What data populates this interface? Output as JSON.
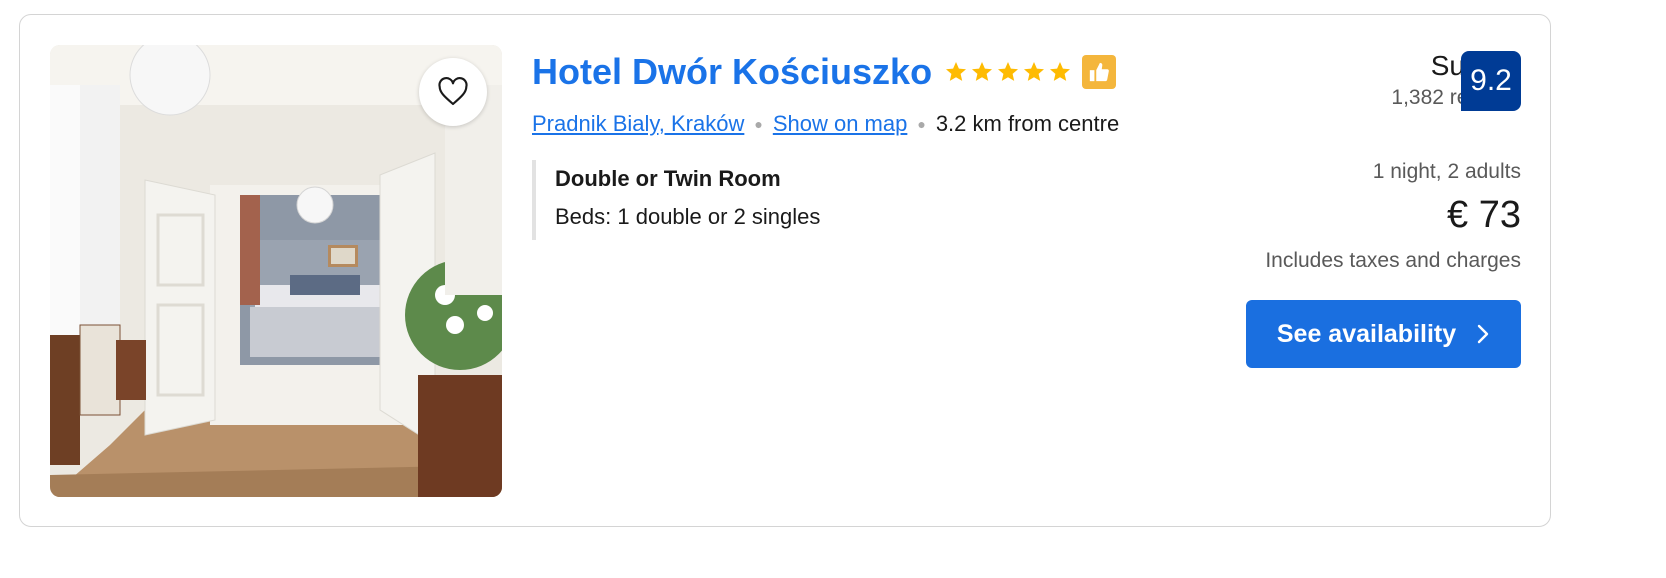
{
  "hotel": {
    "name": "Hotel Dwór Kościuszko",
    "stars": 5,
    "location_link": "Pradnik Bialy, Kraków",
    "map_link": "Show on map",
    "distance": "3.2 km from centre"
  },
  "room": {
    "name": "Double or Twin Room",
    "beds": "Beds: 1 double or 2 singles"
  },
  "review": {
    "label": "Superb",
    "count": "1,382 reviews",
    "score": "9.2"
  },
  "price": {
    "stay": "1 night, 2 adults",
    "amount": "€ 73",
    "taxes": "Includes taxes and charges"
  },
  "cta": {
    "label": "See availability"
  },
  "colors": {
    "link": "#1a73e8",
    "star": "#febb02",
    "score_bg": "#003b95",
    "button": "#1a6fe0",
    "thumb_badge": "#f4b63c"
  },
  "icons": [
    "heart-icon",
    "star-icon",
    "thumbs-up-icon",
    "chevron-right-icon"
  ]
}
